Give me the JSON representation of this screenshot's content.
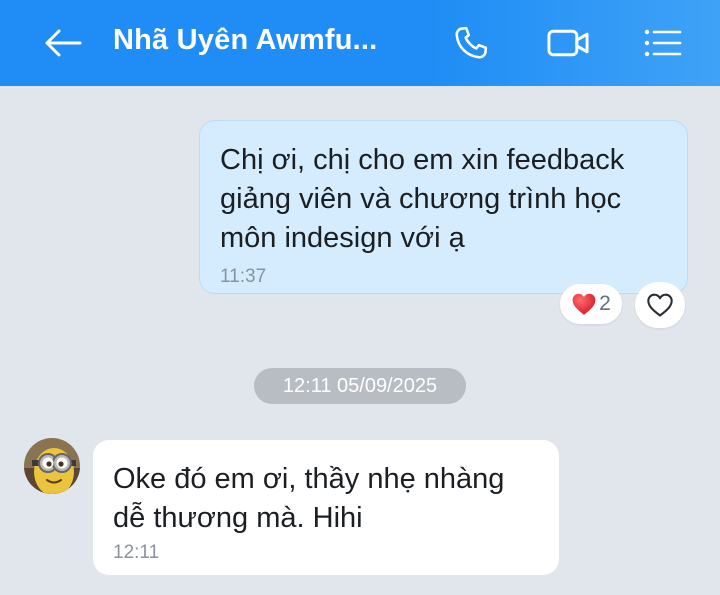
{
  "header": {
    "title": "Nhã Uyên Awmfu...",
    "back_icon": "arrow-left-icon",
    "call_icon": "phone-icon",
    "video_icon": "video-camera-icon",
    "menu_icon": "list-menu-icon",
    "background": "#1f8df5"
  },
  "messages": [
    {
      "direction": "outgoing",
      "text": "Chị ơi, chị cho em xin feedback giảng viên và chương trình học môn indesign với ạ",
      "lines": [
        "Chị ơi, chị cho em xin feedback",
        "giảng viên và chương trình học",
        "môn indesign với ạ"
      ],
      "time": "11:37",
      "reaction": {
        "icon": "heart-icon",
        "count": "2"
      },
      "bubble_color": "#d4ecfd"
    },
    {
      "direction": "incoming",
      "text": "Oke đó em ơi, thầy nhẹ nhàng dễ thương mà. Hihi",
      "lines": [
        "Oke đó em ơi, thầy nhẹ nhàng",
        "dễ thương mà. Hihi"
      ],
      "time": "12:11",
      "avatar": "minion-avatar",
      "bubble_color": "#ffffff"
    }
  ],
  "date_separator": "12:11 05/09/2025",
  "like_icon": "heart-outline-icon",
  "background": "#e1e5ec"
}
